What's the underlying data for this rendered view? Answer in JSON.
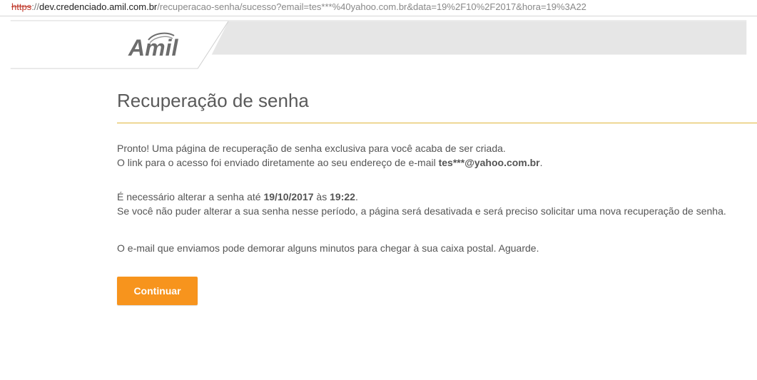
{
  "browser": {
    "url_scheme": "https",
    "url_sep": "://",
    "url_host": "dev.credenciado.amil.com.br",
    "url_path": "/recuperacao-senha/sucesso?email=tes***%40yahoo.com.br&data=19%2F10%2F2017&hora=19%3A22"
  },
  "brand": {
    "logo_text": "Amil"
  },
  "page": {
    "title": "Recuperação de senha",
    "p1_line1": "Pronto! Uma página de recuperação de senha exclusiva para você acaba de ser criada.",
    "p1_line2_prefix": "O link para o acesso foi enviado diretamente ao seu endereço de e-mail ",
    "email": "tes***@yahoo.com.br",
    "p1_line2_suffix": ".",
    "p2_prefix": "É necessário alterar a senha até ",
    "date": "19/10/2017",
    "p2_mid": " às ",
    "time": "19:22",
    "p2_suffix": ".",
    "p2_line2": "Se você não puder alterar a sua senha nesse período, a página será desativada e será preciso solicitar uma nova recuperação de senha.",
    "p3": "O e-mail que enviamos pode demorar alguns minutos para chegar à sua caixa postal. Aguarde.",
    "continue_label": "Continuar"
  },
  "colors": {
    "accent": "#f7941d",
    "rule": "#e0b53a",
    "header_band": "#e6e6e6"
  }
}
